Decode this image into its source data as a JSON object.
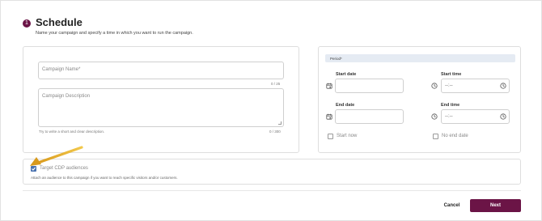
{
  "header": {
    "step_number": "1",
    "title": "Schedule",
    "subtitle": "Name your campaign and specify a time in which you want to run the campaign."
  },
  "campaign": {
    "name_placeholder": "Campaign Name*",
    "name_counter": "0 / 25",
    "description_placeholder": "Campaign Description",
    "description_hint": "Try to write a short and clear description.",
    "description_counter": "0 / 300"
  },
  "period": {
    "label": "Period*",
    "start_date_label": "Start date",
    "start_time_label": "Start time",
    "end_date_label": "End date",
    "end_time_label": "End time",
    "start_time_value": "--:--",
    "end_time_value": "--:--",
    "start_now_label": "Start now",
    "no_end_date_label": "No end date"
  },
  "audience": {
    "checkbox_label": "Target CDP audiences",
    "checked": true,
    "hint": "Attach an audience to this campaign if you want to reach specific visitors and/or customers."
  },
  "footer": {
    "cancel_label": "Cancel",
    "next_label": "Next"
  },
  "colors": {
    "brand": "#6b1446",
    "checkbox_accent": "#4a72b0",
    "arrow": "#e8b62c",
    "period_bar": "#e5ebf3"
  },
  "icons": [
    "calendar-icon",
    "clock-icon",
    "check-icon",
    "arrow-pointer-icon"
  ]
}
